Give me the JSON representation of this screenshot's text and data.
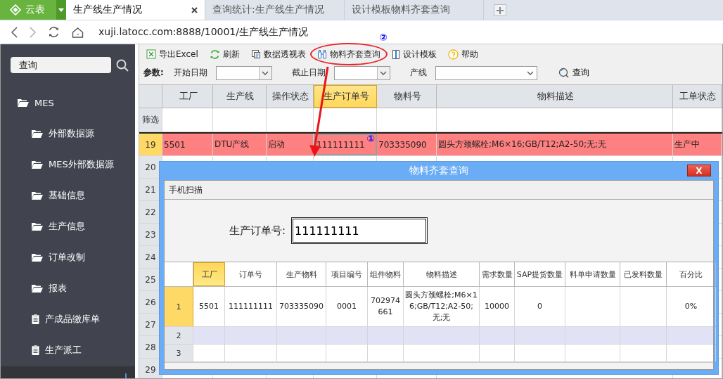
{
  "browser": {
    "logo": "云表",
    "tabs": [
      {
        "label": "生产线生产情况",
        "selected": true,
        "closable": true
      },
      {
        "label": "查询统计:生产线生产情况",
        "selected": false,
        "closable": false
      },
      {
        "label": "设计模板物料齐套查询",
        "selected": false,
        "closable": false
      }
    ],
    "url": "xuji.latocc.com:8888/10001/生产线生产情况"
  },
  "sidebar": {
    "search": {
      "value": "查询"
    },
    "tree": [
      {
        "label": "MES",
        "kind": "folder",
        "expanded": true,
        "children": [
          {
            "label": "外部数据源",
            "kind": "folder"
          },
          {
            "label": "MES外部数据源",
            "kind": "folder"
          },
          {
            "label": "基础信息",
            "kind": "folder"
          },
          {
            "label": "生产信息",
            "kind": "folder"
          },
          {
            "label": "订单改制",
            "kind": "folder"
          },
          {
            "label": "报表",
            "kind": "folder"
          },
          {
            "label": "产成品缴库单",
            "kind": "report"
          },
          {
            "label": "生产派工",
            "kind": "report"
          }
        ]
      }
    ]
  },
  "toolbar": [
    {
      "label": "导出Excel",
      "kind": "excel",
      "circled": false
    },
    {
      "label": "刷新",
      "kind": "refresh",
      "circled": false
    },
    {
      "label": "数据透视表",
      "kind": "pivot",
      "circled": false
    },
    {
      "label": "物料齐套查询",
      "kind": "binoculars",
      "circled": true,
      "mark": "②"
    },
    {
      "label": "设计模板",
      "kind": "template",
      "circled": false
    },
    {
      "label": "帮助",
      "kind": "help",
      "circled": false
    }
  ],
  "params": {
    "label": "参数:",
    "fields": [
      {
        "label": "开始日期"
      },
      {
        "label": "截止日期"
      },
      {
        "label": "产线"
      }
    ],
    "query_button": "查询"
  },
  "grid": {
    "columns": [
      {
        "label": "工厂",
        "selected": false
      },
      {
        "label": "生产线",
        "selected": false
      },
      {
        "label": "操作状态",
        "selected": false
      },
      {
        "label": "生产订单号",
        "selected": true
      },
      {
        "label": "物料号",
        "selected": false
      },
      {
        "label": "物料描述",
        "selected": false
      },
      {
        "label": "工单状态",
        "selected": false
      }
    ],
    "filter_label": "筛选",
    "focus_mark": "①",
    "rows": [
      {
        "number": "19",
        "selected": true,
        "cells": [
          "5501",
          "DTU产线",
          "启动",
          "111111111",
          "703335090",
          "圆头方颈螺栓;M6×16;GB/T12;A2-50;无;无",
          "生产中"
        ]
      },
      {
        "number": "20",
        "selected": false,
        "cells": []
      },
      {
        "number": "21",
        "selected": false,
        "cells": []
      },
      {
        "number": "22",
        "selected": false,
        "cells": []
      },
      {
        "number": "23",
        "selected": false,
        "cells": []
      },
      {
        "number": "24",
        "selected": false,
        "cells": []
      },
      {
        "number": "25",
        "selected": false,
        "cells": []
      },
      {
        "number": "26",
        "selected": false,
        "cells": []
      },
      {
        "number": "27",
        "selected": false,
        "cells": []
      },
      {
        "number": "28",
        "selected": false,
        "cells": []
      },
      {
        "number": "29",
        "selected": false,
        "cells": []
      }
    ]
  },
  "dialog": {
    "title": "物料齐套查询",
    "close": "X",
    "toolbar": "手机扫描",
    "field": {
      "label": "生产订单号:",
      "value": "111111111"
    },
    "grid": {
      "columns": [
        {
          "label": "工厂",
          "selected": true
        },
        {
          "label": "订单号",
          "selected": false
        },
        {
          "label": "生产物料",
          "selected": false
        },
        {
          "label": "项目编号",
          "selected": false
        },
        {
          "label": "组件物料",
          "selected": false
        },
        {
          "label": "物料描述",
          "selected": false
        },
        {
          "label": "需求数量",
          "selected": false
        },
        {
          "label": "SAP提货数量",
          "selected": false
        },
        {
          "label": "料单申请数量",
          "selected": false
        },
        {
          "label": "已发料数量",
          "selected": false
        },
        {
          "label": "百分比",
          "selected": false
        }
      ],
      "rows": [
        {
          "number": "1",
          "selected": true,
          "hovered": false,
          "cells": [
            "5501",
            "111111111",
            "703335090",
            "0001",
            "702974661",
            "圆头方颈螺栓;M6×16;GB/T12;A2-50;无;无",
            "10000",
            "0",
            "",
            "",
            "0%"
          ]
        },
        {
          "number": "2",
          "selected": false,
          "hovered": true,
          "cells": []
        },
        {
          "number": "3",
          "selected": false,
          "hovered": false,
          "cells": []
        }
      ]
    }
  }
}
